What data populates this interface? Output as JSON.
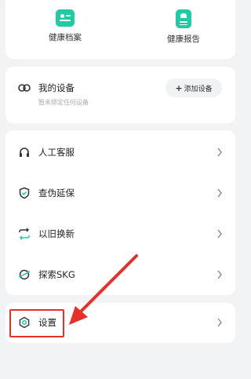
{
  "health": {
    "records_label": "健康档案",
    "report_label": "健康报告"
  },
  "device": {
    "title": "我的设备",
    "subtitle": "暂未绑定任何设备",
    "add_button": "添加设备"
  },
  "menu": {
    "items": [
      {
        "label": "人工客服",
        "icon": "headset-icon"
      },
      {
        "label": "查伪延保",
        "icon": "shield-check-icon"
      },
      {
        "label": "以旧换新",
        "icon": "exchange-icon"
      },
      {
        "label": "探索SKG",
        "icon": "explore-icon"
      }
    ]
  },
  "settings": {
    "label": "设置",
    "icon": "settings-icon"
  },
  "colors": {
    "accent": "#23c9a5",
    "highlight": "#e8302a"
  }
}
